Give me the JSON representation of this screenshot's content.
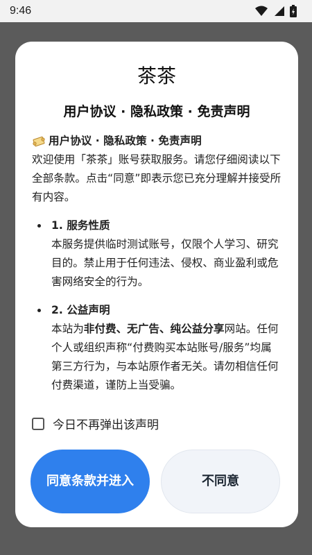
{
  "status_bar": {
    "time": "9:46",
    "icons": [
      "wifi-icon",
      "cellular-icon",
      "battery-icon"
    ]
  },
  "dialog": {
    "app_title": "茶茶",
    "heading": "用户协议 · 隐私政策 · 免责声明",
    "intro_heading": "用户协议 · 隐私政策 · 免责声明",
    "intro_icon": "scroll-icon",
    "intro_text": "欢迎使用「茶茶」账号获取服务。请您仔细阅读以下全部条款。点击“同意”即表示您已充分理解并接受所有内容。",
    "sections": [
      {
        "title": "1. 服务性质",
        "text": "本服务提供临时测试账号，仅限个人学习、研究目的。禁止用于任何违法、侵权、商业盈利或危害网络安全的行为。"
      },
      {
        "title": "2. 公益声明",
        "text_prefix": "本站为",
        "text_strong": "非付费、无广告、纯公益分享",
        "text_suffix": "网站。任何个人或组织声称“付费购买本站账号/服务”均属第三方行为，与本站原作者无关。请勿相信任何付费渠道，谨防上当受骗。"
      }
    ],
    "checkbox_label": "今日不再弹出该声明",
    "checkbox_checked": false,
    "agree_button": "同意条款并进入",
    "disagree_button": "不同意"
  },
  "colors": {
    "primary": "#2f80ed",
    "secondary_button": "#f1f4f9",
    "overlay": "#5b5b5b"
  }
}
